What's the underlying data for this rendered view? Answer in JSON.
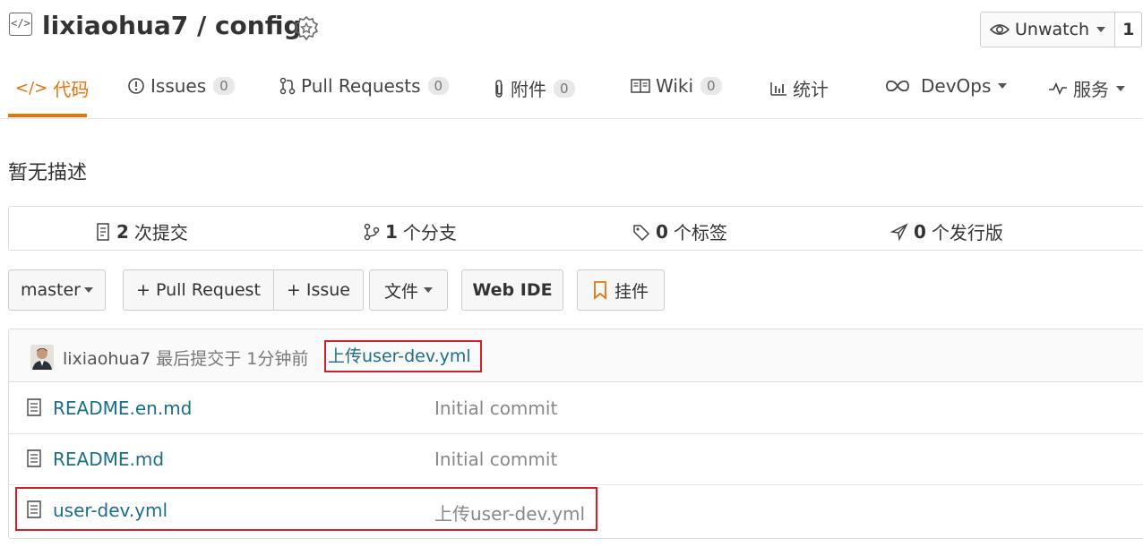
{
  "header": {
    "repo_title": "lixiaohua7 / config",
    "watch_label": "Unwatch",
    "watch_count": "1"
  },
  "tabs": [
    {
      "label": "代码",
      "icon": "code-icon",
      "active": true
    },
    {
      "label": "Issues",
      "count": "0",
      "icon": "issue-icon"
    },
    {
      "label": "Pull Requests",
      "count": "0",
      "icon": "pull-request-icon"
    },
    {
      "label": "附件",
      "count": "0",
      "icon": "paperclip-icon"
    },
    {
      "label": "Wiki",
      "count": "0",
      "icon": "book-icon"
    },
    {
      "label": "统计",
      "icon": "bar-chart-icon"
    },
    {
      "label": "DevOps",
      "icon": "infinity-icon",
      "dropdown": true
    },
    {
      "label": "服务",
      "icon": "pulse-icon",
      "dropdown": true
    }
  ],
  "description": "暂无描述",
  "stats": {
    "commits": {
      "count": "2",
      "label": "次提交"
    },
    "branches": {
      "count": "1",
      "label": "个分支"
    },
    "tags": {
      "count": "0",
      "label": "个标签"
    },
    "releases": {
      "count": "0",
      "label": "个发行版"
    }
  },
  "toolbar": {
    "branch": "master",
    "pull_request": "+ Pull Request",
    "issue": "+ Issue",
    "file": "文件",
    "web_ide": "Web IDE",
    "widget": "挂件"
  },
  "latest_commit": {
    "author": "lixiaohua7",
    "meta": "最后提交于 1分钟前",
    "message": "上传user-dev.yml"
  },
  "files": [
    {
      "name": "README.en.md",
      "message": "Initial commit"
    },
    {
      "name": "README.md",
      "message": "Initial commit"
    },
    {
      "name": "user-dev.yml",
      "message": "上传user-dev.yml"
    }
  ],
  "colors": {
    "accent": "#e4750f",
    "link": "#1a6f8a",
    "highlight": "#d0212b"
  }
}
